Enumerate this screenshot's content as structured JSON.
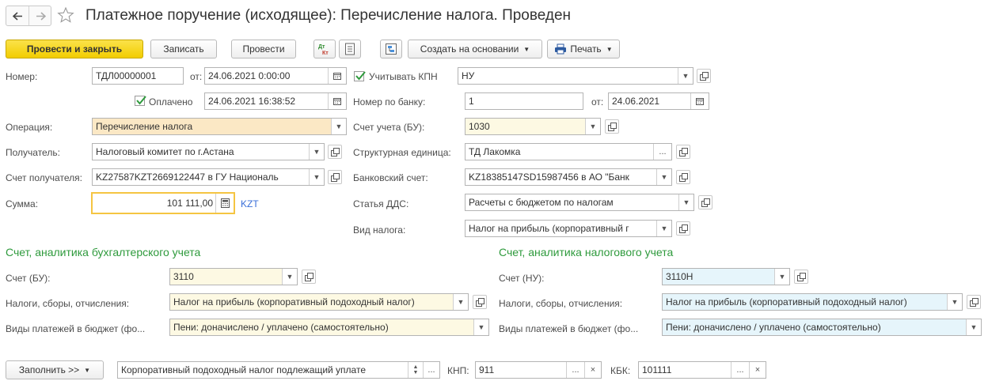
{
  "title": "Платежное поручение (исходящее): Перечисление налога. Проведен",
  "toolbar": {
    "post_close": "Провести и закрыть",
    "save": "Записать",
    "post": "Провести",
    "create_based": "Создать на основании",
    "print": "Печать"
  },
  "header": {
    "number_label": "Номер:",
    "number": "ТДЛ00000001",
    "from_label": "от:",
    "date": "24.06.2021  0:00:00",
    "kpn_label": "Учитывать КПН",
    "kpn_value": "НУ",
    "paid_label": "Оплачено",
    "paid_date": "24.06.2021 16:38:52",
    "bank_number_label": "Номер по банку:",
    "bank_number": "1",
    "bank_from_label": "от:",
    "bank_date": "24.06.2021"
  },
  "left": {
    "operation_label": "Операция:",
    "operation": "Перечисление налога",
    "recipient_label": "Получатель:",
    "recipient": "Налоговый комитет по г.Астана",
    "recipient_account_label": "Счет получателя:",
    "recipient_account": "KZ27587KZT2669122447 в ГУ Националь",
    "amount_label": "Сумма:",
    "amount": "101 111,00",
    "currency": "KZT"
  },
  "right": {
    "account_bu_label": "Счет учета (БУ):",
    "account_bu": "1030",
    "unit_label": "Структурная единица:",
    "unit": "ТД Лакомка",
    "bank_account_label": "Банковский счет:",
    "bank_account": "KZ18385147SD15987456 в АО \"Банк",
    "dds_label": "Статья ДДС:",
    "dds": "Расчеты с бюджетом по налогам",
    "tax_type_label": "Вид налога:",
    "tax_type": "Налог на прибыль (корпоративный г"
  },
  "bu": {
    "title": "Счет, аналитика бухгалтерского учета",
    "account_label": "Счет (БУ):",
    "account": "3110",
    "taxes_label": "Налоги, сборы, отчисления:",
    "taxes": "Налог на прибыль (корпоративный подоходный налог)",
    "payments_label": "Виды платежей в бюджет (фо...",
    "payments": "Пени: доначислено / уплачено (самостоятельно)"
  },
  "nu": {
    "title": "Счет, аналитика налогового учета",
    "account_label": "Счет (НУ):",
    "account": "3110Н",
    "taxes_label": "Налоги, сборы, отчисления:",
    "taxes": "Налог на прибыль (корпоративный подоходный налог)",
    "payments_label": "Виды платежей в бюджет (фо...",
    "payments": "Пени: доначислено / уплачено (самостоятельно)"
  },
  "footer": {
    "fill_label": "Заполнить >>",
    "purpose": "Корпоративный подоходный налог подлежащий уплате",
    "knp_label": "КНП:",
    "knp": "911",
    "kbk_label": "КБК:",
    "kbk": "101111"
  },
  "colors": {
    "accent_yellow": "#f5d200",
    "section_green": "#2e9a3c",
    "link_blue": "#3a6fd8"
  }
}
